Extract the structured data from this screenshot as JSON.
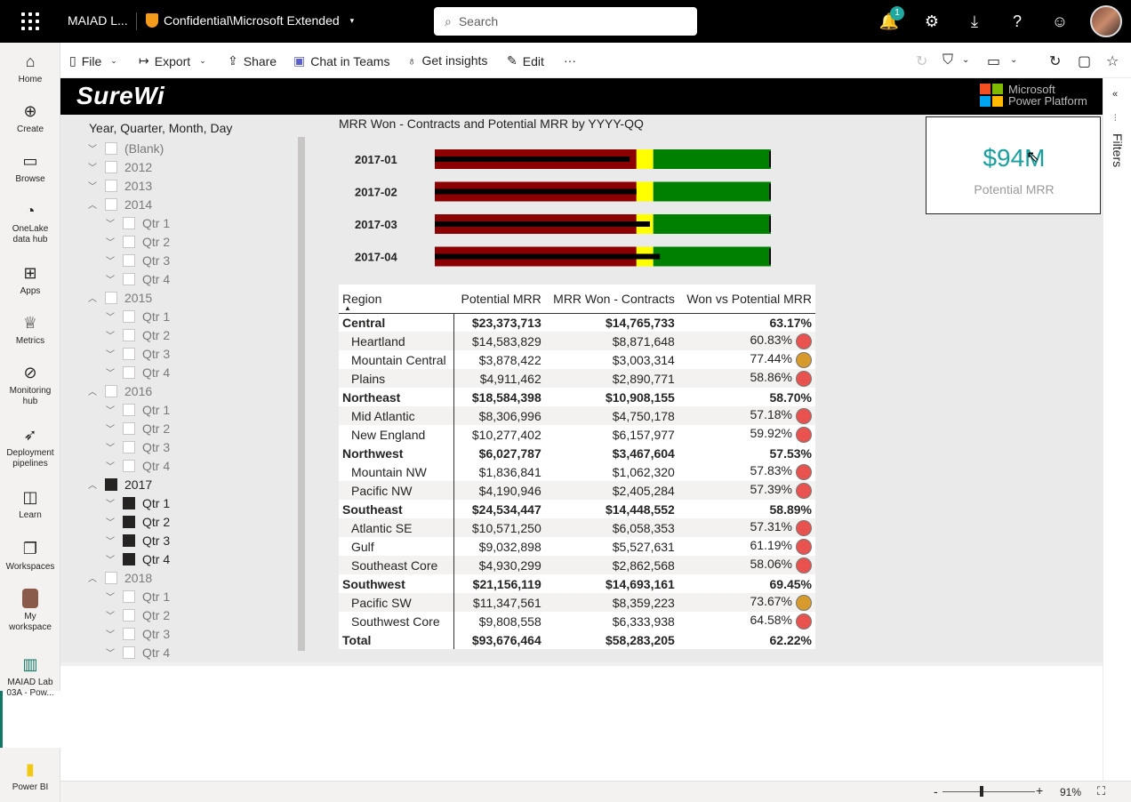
{
  "topbar": {
    "app_name": "MAIAD L...",
    "sensitivity": "Confidential\\Microsoft Extended",
    "search_placeholder": "Search",
    "notification_count": "1"
  },
  "leftnav": [
    {
      "label": "Home",
      "icon": "home-icon"
    },
    {
      "label": "Create",
      "icon": "plus-circle-icon"
    },
    {
      "label": "Browse",
      "icon": "folder-icon"
    },
    {
      "label": "OneLake data hub",
      "icon": "onelake-icon"
    },
    {
      "label": "Apps",
      "icon": "apps-icon"
    },
    {
      "label": "Metrics",
      "icon": "trophy-icon"
    },
    {
      "label": "Monitoring hub",
      "icon": "monitor-icon"
    },
    {
      "label": "Deployment pipelines",
      "icon": "rocket-icon"
    },
    {
      "label": "Learn",
      "icon": "book-icon"
    },
    {
      "label": "Workspaces",
      "icon": "workspaces-icon"
    },
    {
      "label": "My workspace",
      "icon": "user-avatar-icon"
    },
    {
      "label": "MAIAD Lab 03A - Pow...",
      "icon": "report-icon"
    },
    {
      "label": "Power BI",
      "icon": "powerbi-icon"
    }
  ],
  "commandbar": {
    "file": "File",
    "export": "Export",
    "share": "Share",
    "chat": "Chat in Teams",
    "insights": "Get insights",
    "edit": "Edit",
    "more": "···"
  },
  "report": {
    "logo": "SureWi",
    "brand_line1": "Microsoft",
    "brand_line2": "Power Platform",
    "colors": {
      "ms_red": "#f25022",
      "ms_green": "#7fba00",
      "ms_blue": "#00a4ef",
      "ms_yellow": "#ffb900"
    }
  },
  "slicer": {
    "title": "Year, Quarter, Month, Day",
    "items": [
      {
        "label": "(Blank)",
        "level": 0,
        "expanded": false,
        "checked": false
      },
      {
        "label": "2012",
        "level": 0,
        "expanded": false,
        "checked": false
      },
      {
        "label": "2013",
        "level": 0,
        "expanded": false,
        "checked": false
      },
      {
        "label": "2014",
        "level": 0,
        "expanded": true,
        "checked": false
      },
      {
        "label": "Qtr 1",
        "level": 1,
        "expanded": false,
        "checked": false
      },
      {
        "label": "Qtr 2",
        "level": 1,
        "expanded": false,
        "checked": false
      },
      {
        "label": "Qtr 3",
        "level": 1,
        "expanded": false,
        "checked": false
      },
      {
        "label": "Qtr 4",
        "level": 1,
        "expanded": false,
        "checked": false
      },
      {
        "label": "2015",
        "level": 0,
        "expanded": true,
        "checked": false
      },
      {
        "label": "Qtr 1",
        "level": 1,
        "expanded": false,
        "checked": false
      },
      {
        "label": "Qtr 2",
        "level": 1,
        "expanded": false,
        "checked": false
      },
      {
        "label": "Qtr 3",
        "level": 1,
        "expanded": false,
        "checked": false
      },
      {
        "label": "Qtr 4",
        "level": 1,
        "expanded": false,
        "checked": false
      },
      {
        "label": "2016",
        "level": 0,
        "expanded": true,
        "checked": false
      },
      {
        "label": "Qtr 1",
        "level": 1,
        "expanded": false,
        "checked": false
      },
      {
        "label": "Qtr 2",
        "level": 1,
        "expanded": false,
        "checked": false
      },
      {
        "label": "Qtr 3",
        "level": 1,
        "expanded": false,
        "checked": false
      },
      {
        "label": "Qtr 4",
        "level": 1,
        "expanded": false,
        "checked": false
      },
      {
        "label": "2017",
        "level": 0,
        "expanded": true,
        "checked": true
      },
      {
        "label": "Qtr 1",
        "level": 1,
        "expanded": false,
        "checked": true
      },
      {
        "label": "Qtr 2",
        "level": 1,
        "expanded": false,
        "checked": true
      },
      {
        "label": "Qtr 3",
        "level": 1,
        "expanded": false,
        "checked": true
      },
      {
        "label": "Qtr 4",
        "level": 1,
        "expanded": false,
        "checked": true
      },
      {
        "label": "2018",
        "level": 0,
        "expanded": true,
        "checked": false
      },
      {
        "label": "Qtr 1",
        "level": 1,
        "expanded": false,
        "checked": false
      },
      {
        "label": "Qtr 2",
        "level": 1,
        "expanded": false,
        "checked": false
      },
      {
        "label": "Qtr 3",
        "level": 1,
        "expanded": false,
        "checked": false
      },
      {
        "label": "Qtr 4",
        "level": 1,
        "expanded": false,
        "checked": false
      }
    ]
  },
  "kpi": {
    "value": "$94M",
    "label": "Potential MRR",
    "color": "#1a9e9e"
  },
  "chart_data": {
    "type": "bar",
    "title": "MRR Won - Contracts and Potential MRR by YYYY-QQ",
    "categories": [
      "2017-01",
      "2017-02",
      "2017-03",
      "2017-04"
    ],
    "bands": {
      "red_to": 60,
      "yellow_to": 65,
      "green_to": 100
    },
    "colors": {
      "red": "#8b0000",
      "yellow": "#ffff00",
      "green": "#008000",
      "bar": "#000000"
    },
    "series": [
      {
        "values": [
          58,
          60,
          64,
          67
        ]
      }
    ],
    "ylim": [
      0,
      100
    ],
    "legend": "none"
  },
  "matrix": {
    "headers": [
      "Region",
      "Potential MRR",
      "MRR Won - Contracts",
      "Won vs Potential MRR"
    ],
    "rows": [
      {
        "region": "Central",
        "potential": "$23,373,713",
        "won": "$14,765,733",
        "pct": "63.17%",
        "bold": true,
        "status": ""
      },
      {
        "region": "Heartland",
        "potential": "$14,583,829",
        "won": "$8,871,648",
        "pct": "60.83%",
        "bold": false,
        "status": "red"
      },
      {
        "region": "Mountain Central",
        "potential": "$3,878,422",
        "won": "$3,003,314",
        "pct": "77.44%",
        "bold": false,
        "status": "amber"
      },
      {
        "region": "Plains",
        "potential": "$4,911,462",
        "won": "$2,890,771",
        "pct": "58.86%",
        "bold": false,
        "status": "red"
      },
      {
        "region": "Northeast",
        "potential": "$18,584,398",
        "won": "$10,908,155",
        "pct": "58.70%",
        "bold": true,
        "status": ""
      },
      {
        "region": "Mid Atlantic",
        "potential": "$8,306,996",
        "won": "$4,750,178",
        "pct": "57.18%",
        "bold": false,
        "status": "red"
      },
      {
        "region": "New England",
        "potential": "$10,277,402",
        "won": "$6,157,977",
        "pct": "59.92%",
        "bold": false,
        "status": "red"
      },
      {
        "region": "Northwest",
        "potential": "$6,027,787",
        "won": "$3,467,604",
        "pct": "57.53%",
        "bold": true,
        "status": ""
      },
      {
        "region": "Mountain NW",
        "potential": "$1,836,841",
        "won": "$1,062,320",
        "pct": "57.83%",
        "bold": false,
        "status": "red"
      },
      {
        "region": "Pacific NW",
        "potential": "$4,190,946",
        "won": "$2,405,284",
        "pct": "57.39%",
        "bold": false,
        "status": "red"
      },
      {
        "region": "Southeast",
        "potential": "$24,534,447",
        "won": "$14,448,552",
        "pct": "58.89%",
        "bold": true,
        "status": ""
      },
      {
        "region": "Atlantic SE",
        "potential": "$10,571,250",
        "won": "$6,058,353",
        "pct": "57.31%",
        "bold": false,
        "status": "red"
      },
      {
        "region": "Gulf",
        "potential": "$9,032,898",
        "won": "$5,527,631",
        "pct": "61.19%",
        "bold": false,
        "status": "red"
      },
      {
        "region": "Southeast Core",
        "potential": "$4,930,299",
        "won": "$2,862,568",
        "pct": "58.06%",
        "bold": false,
        "status": "red"
      },
      {
        "region": "Southwest",
        "potential": "$21,156,119",
        "won": "$14,693,161",
        "pct": "69.45%",
        "bold": true,
        "status": ""
      },
      {
        "region": "Pacific SW",
        "potential": "$11,347,561",
        "won": "$8,359,223",
        "pct": "73.67%",
        "bold": false,
        "status": "amber"
      },
      {
        "region": "Southwest Core",
        "potential": "$9,808,558",
        "won": "$6,333,938",
        "pct": "64.58%",
        "bold": false,
        "status": "red"
      },
      {
        "region": "Total",
        "potential": "$93,676,464",
        "won": "$58,283,205",
        "pct": "62.22%",
        "bold": true,
        "status": ""
      }
    ],
    "status_colors": {
      "red": "#e8524f",
      "amber": "#d69a2d"
    }
  },
  "filters": {
    "label": "Filters"
  },
  "statusbar": {
    "zoom": "91%",
    "minus": "-",
    "plus": "+"
  }
}
